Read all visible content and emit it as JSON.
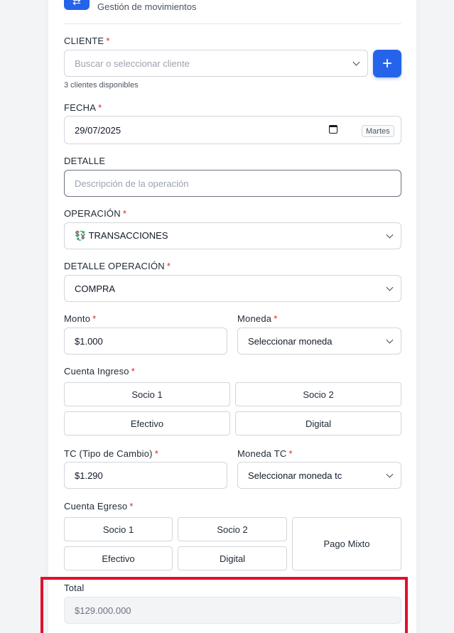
{
  "header": {
    "subtitle": "Gestión de movimientos"
  },
  "cliente": {
    "label": "CLIENTE",
    "placeholder": "Buscar o seleccionar cliente",
    "hint": "3 clientes disponibles",
    "add_label": "+"
  },
  "fecha": {
    "label": "FECHA",
    "value": "29/07/2025",
    "day_badge": "Martes"
  },
  "detalle": {
    "label": "DETALLE",
    "placeholder": "Descripción de la operación"
  },
  "operacion": {
    "label": "OPERACIÓN",
    "value": "💱 TRANSACCIONES"
  },
  "detalle_operacion": {
    "label": "DETALLE OPERACIÓN",
    "value": "COMPRA"
  },
  "monto": {
    "label": "Monto",
    "value": "$1.000"
  },
  "moneda": {
    "label": "Moneda",
    "value": "Seleccionar moneda"
  },
  "cuenta_ingreso": {
    "label": "Cuenta Ingreso",
    "options": [
      "Socio 1",
      "Socio 2",
      "Efectivo",
      "Digital"
    ]
  },
  "tc": {
    "label": "TC (Tipo de Cambio)",
    "value": "$1.290"
  },
  "moneda_tc": {
    "label": "Moneda TC",
    "value": "Seleccionar moneda tc"
  },
  "cuenta_egreso": {
    "label": "Cuenta Egreso",
    "options": [
      "Socio 1",
      "Socio 2",
      "Efectivo",
      "Digital",
      "Pago Mixto"
    ]
  },
  "total": {
    "label": "Total",
    "value": "$129.000.000"
  },
  "required_mark": "*",
  "colors": {
    "accent": "#2563eb",
    "required": "#dc2626",
    "highlight": "#e0112b"
  }
}
